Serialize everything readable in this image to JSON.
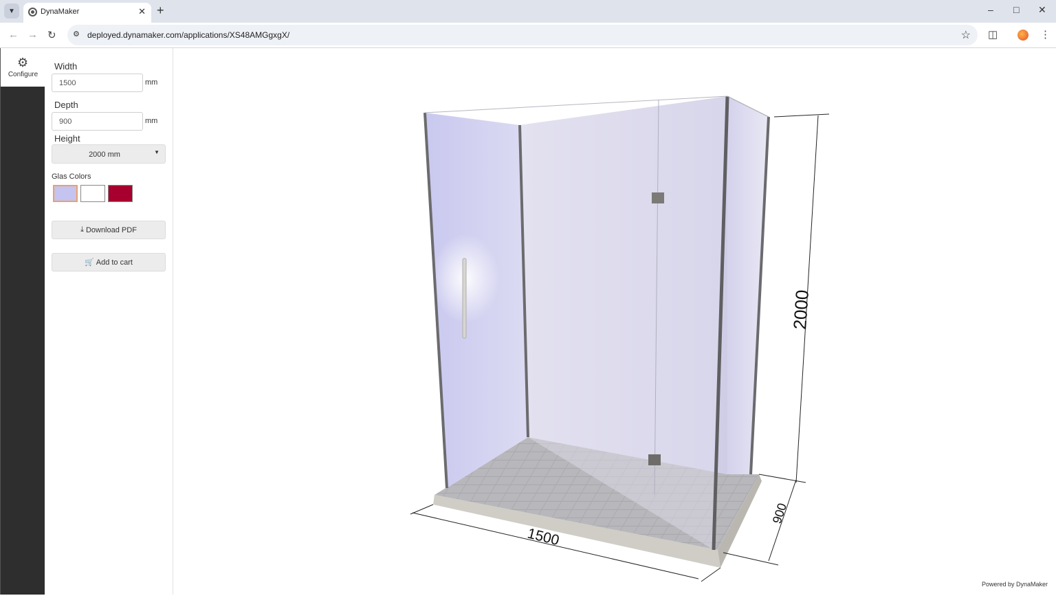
{
  "browser": {
    "tab_title": "DynaMaker",
    "url": "deployed.dynamaker.com/applications/XS48AMGgxgX/"
  },
  "rail": {
    "configure_label": "Configure"
  },
  "config": {
    "width_label": "Width",
    "width_value": "1500",
    "width_unit": "mm",
    "depth_label": "Depth",
    "depth_value": "900",
    "depth_unit": "mm",
    "height_label": "Height",
    "height_value": "2000 mm",
    "colors_label": "Glas Colors",
    "colors": [
      {
        "hex": "#c5c3f0",
        "selected": true
      },
      {
        "hex": "#ffffff",
        "selected": false
      },
      {
        "hex": "#a8002e",
        "selected": false
      }
    ],
    "download_label": "Download PDF",
    "cart_label": "Add to cart"
  },
  "viewport": {
    "dim_width": "1500",
    "dim_depth": "900",
    "dim_height": "2000",
    "powered_by": "Powered by DynaMaker"
  }
}
